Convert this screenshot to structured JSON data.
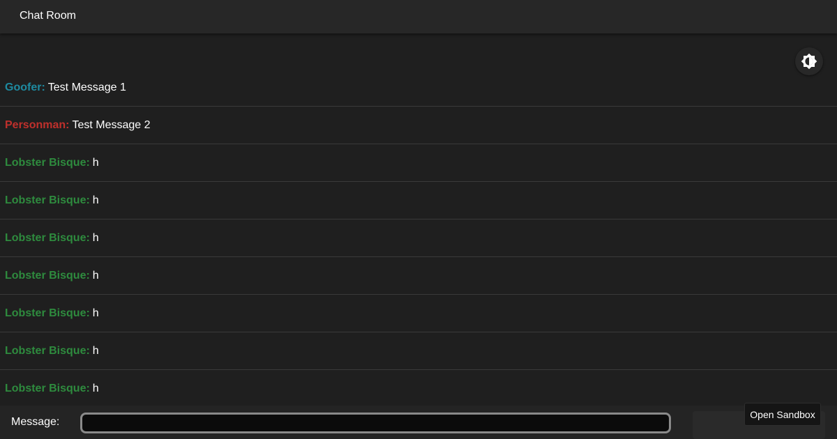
{
  "app": {
    "title": "Chat Room"
  },
  "theme_toggle": {
    "icon": "brightness-icon"
  },
  "messages": [
    {
      "author": "Goofer:",
      "text": "Test Message 1",
      "color": "#1e8aa0"
    },
    {
      "author": "Personman:",
      "text": "Test Message 2",
      "color": "#c0302c"
    },
    {
      "author": "Lobster Bisque:",
      "text": "h",
      "color": "#2e8b3e"
    },
    {
      "author": "Lobster Bisque:",
      "text": "h",
      "color": "#2e8b3e"
    },
    {
      "author": "Lobster Bisque:",
      "text": "h",
      "color": "#2e8b3e"
    },
    {
      "author": "Lobster Bisque:",
      "text": "h",
      "color": "#2e8b3e"
    },
    {
      "author": "Lobster Bisque:",
      "text": "h",
      "color": "#2e8b3e"
    },
    {
      "author": "Lobster Bisque:",
      "text": "h",
      "color": "#2e8b3e"
    },
    {
      "author": "Lobster Bisque:",
      "text": "h",
      "color": "#2e8b3e"
    }
  ],
  "composer": {
    "label": "Message:",
    "value": "",
    "placeholder": ""
  },
  "sandbox": {
    "label": "Open Sandbox"
  },
  "colors": {
    "background": "#1f1f1f",
    "appbar": "#272727"
  }
}
